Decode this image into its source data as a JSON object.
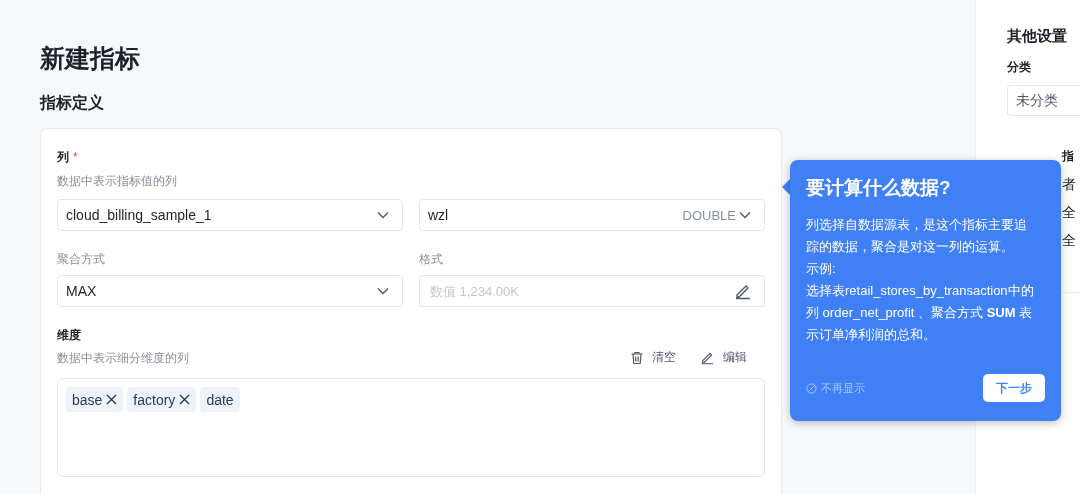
{
  "page": {
    "title": "新建指标"
  },
  "definition": {
    "heading": "指标定义",
    "column": {
      "label": "列",
      "required_mark": "*",
      "hint": "数据中表示指标值的列",
      "table_select": {
        "value": "cloud_billing_sample_1"
      },
      "column_select": {
        "value": "wzl",
        "type": "DOUBLE"
      }
    },
    "aggregation": {
      "label": "聚合方式",
      "value": "MAX"
    },
    "format": {
      "label": "格式",
      "placeholder": "数值 1,234.00K"
    },
    "dimensions": {
      "label": "维度",
      "hint": "数据中表示细分维度的列",
      "actions": [
        {
          "label": "清空",
          "kind": "clear"
        },
        {
          "label": "编辑",
          "kind": "edit"
        }
      ],
      "tags": [
        {
          "label": "base",
          "removable": true
        },
        {
          "label": "factory",
          "removable": true
        },
        {
          "label": "date",
          "removable": false
        }
      ]
    }
  },
  "other_settings": {
    "heading": "其他设置",
    "category": {
      "label": "分类",
      "value": "未分类"
    },
    "covered_texts": [
      "指",
      "者",
      "全",
      "全"
    ]
  },
  "guide": {
    "title": "要计算什么数据?",
    "body": [
      "列选择自数据源表，是这个指标主要追踪的数据，聚合是对这一列的运算。",
      "示例:",
      "选择表retail_stores_by_transaction中的列 order_net_profit 、聚合方式 **SUM** 表示订单净利润的总和。"
    ],
    "dismiss": "不再显示",
    "next_button": "下一步"
  }
}
